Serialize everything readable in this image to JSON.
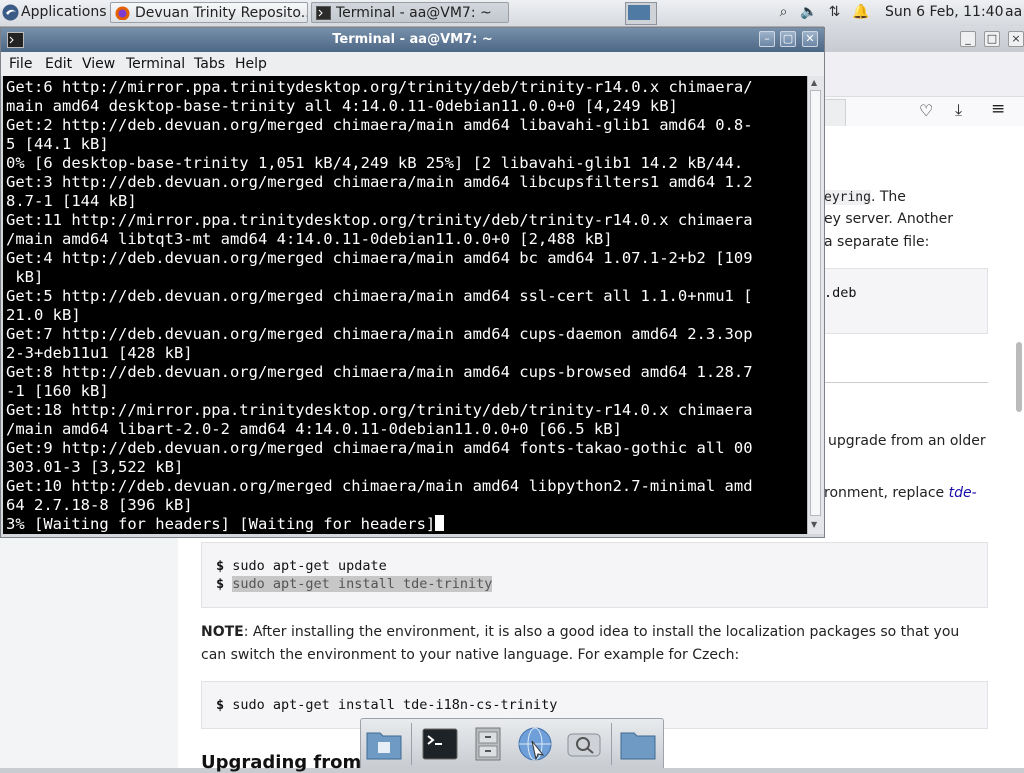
{
  "taskbar": {
    "applications_label": "Applications",
    "tasks": [
      {
        "label": "Devuan Trinity Reposito...",
        "icon": "firefox-icon"
      },
      {
        "label": "Terminal - aa@VM7: ~",
        "icon": "terminal-icon"
      }
    ],
    "clock": "Sun  6 Feb, 11:40",
    "user": "aa"
  },
  "terminal": {
    "title": "Terminal - aa@VM7: ~",
    "menu": [
      "File",
      "Edit",
      "View",
      "Terminal",
      "Tabs",
      "Help"
    ],
    "lines": [
      "Get:6 http://mirror.ppa.trinitydesktop.org/trinity/deb/trinity-r14.0.x chimaera/",
      "main amd64 desktop-base-trinity all 4:14.0.11-0debian11.0.0+0 [4,249 kB]",
      "Get:2 http://deb.devuan.org/merged chimaera/main amd64 libavahi-glib1 amd64 0.8-",
      "5 [44.1 kB]",
      "0% [6 desktop-base-trinity 1,051 kB/4,249 kB 25%] [2 libavahi-glib1 14.2 kB/44.",
      "Get:3 http://deb.devuan.org/merged chimaera/main amd64 libcupsfilters1 amd64 1.2",
      "8.7-1 [144 kB]",
      "Get:11 http://mirror.ppa.trinitydesktop.org/trinity/deb/trinity-r14.0.x chimaera",
      "/main amd64 libtqt3-mt amd64 4:14.0.11-0debian11.0.0+0 [2,488 kB]",
      "Get:4 http://deb.devuan.org/merged chimaera/main amd64 bc amd64 1.07.1-2+b2 [109",
      " kB]",
      "Get:5 http://deb.devuan.org/merged chimaera/main amd64 ssl-cert all 1.1.0+nmu1 [",
      "21.0 kB]",
      "Get:7 http://deb.devuan.org/merged chimaera/main amd64 cups-daemon amd64 2.3.3op",
      "2-3+deb11u1 [428 kB]",
      "Get:8 http://deb.devuan.org/merged chimaera/main amd64 cups-browsed amd64 1.28.7",
      "-1 [160 kB]",
      "Get:18 http://mirror.ppa.trinitydesktop.org/trinity/deb/trinity-r14.0.x chimaera",
      "/main amd64 libart-2.0-2 amd64 4:14.0.11-0debian11.0.0+0 [66.5 kB]",
      "Get:9 http://deb.devuan.org/merged chimaera/main amd64 fonts-takao-gothic all 00",
      "303.01-3 [3,522 kB]",
      "Get:10 http://deb.devuan.org/merged chimaera/main amd64 libpython2.7-minimal amd",
      "64 2.7.18-8 [396 kB]",
      "3% [Waiting for headers] [Waiting for headers]"
    ]
  },
  "webpage": {
    "partial_text": {
      "keyring": "eyring",
      "keyring_after": ". The",
      "line2": "ey server. Another",
      "line3": "a separate file:",
      "deb": ".deb",
      "upgrade": "upgrade from an older",
      "environment": "ronment, replace ",
      "tde": "tde-"
    },
    "commands_block1": [
      {
        "prompt": "$",
        "cmd": "sudo apt-get update"
      },
      {
        "prompt": "$",
        "cmd": "sudo apt-get install tde-trinity"
      }
    ],
    "note_label": "NOTE",
    "note_text_1": ": After installing the environment, it is also a good idea to install the localization packages so that you",
    "note_text_2": "can switch the environment to your native language. For example for Czech:",
    "commands_block2": [
      {
        "prompt": "$",
        "cmd": "sudo apt-get install tde-i18n-cs-trinity"
      }
    ],
    "heading_partial": "Upgrading from"
  },
  "colors": {
    "title_bar": "#4c6685",
    "terminal_bg": "#000000",
    "terminal_fg": "#ffffff",
    "link": "#1a0dab"
  }
}
